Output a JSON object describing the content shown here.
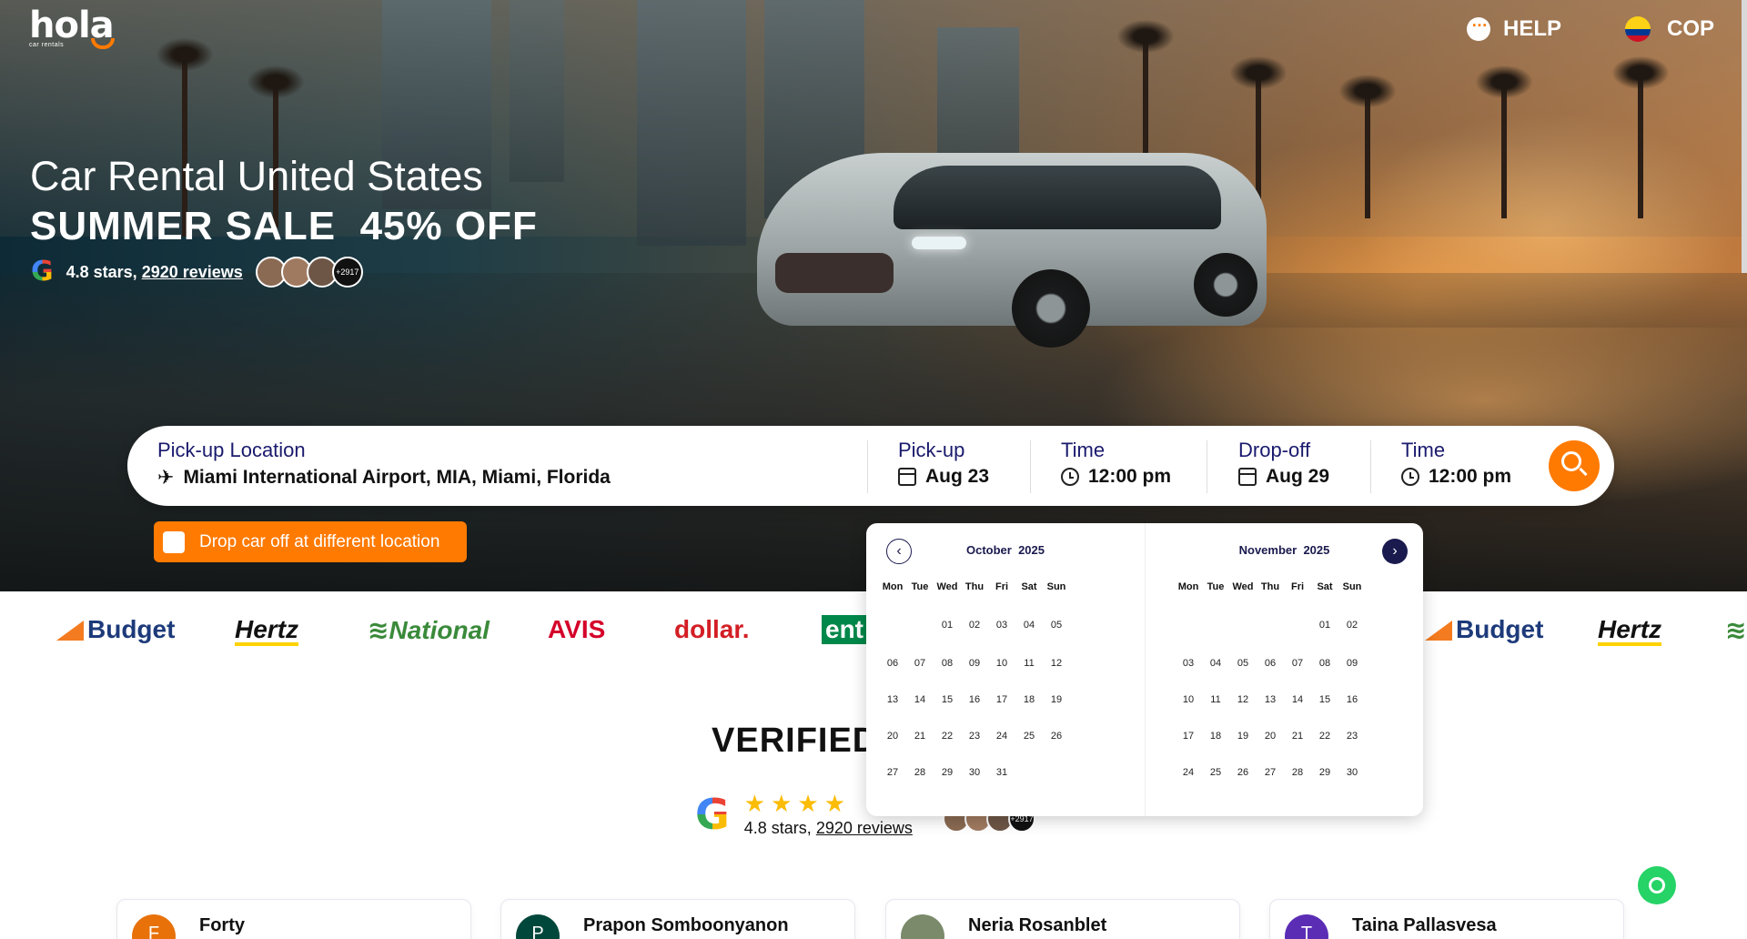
{
  "brand": {
    "name": "hola",
    "sub": "car rentals"
  },
  "topbar": {
    "help_label": "HELP",
    "currency_label": "COP"
  },
  "hero": {
    "title": "Car Rental United States",
    "sale": "SUMMER SALE  45% OFF",
    "rating_text": "4.8 stars,",
    "reviews_link": "2920 reviews",
    "avatars_more": "+2917"
  },
  "search": {
    "pickup_location_label": "Pick-up Location",
    "pickup_location_value": "Miami International Airport, MIA, Miami, Florida",
    "pickup_label": "Pick-up",
    "pickup_date": "Aug 23",
    "pickup_time_label": "Time",
    "pickup_time": "12:00 pm",
    "dropoff_label": "Drop-off",
    "dropoff_date": "Aug 29",
    "dropoff_time_label": "Time",
    "dropoff_time": "12:00 pm",
    "different_location_label": "Drop car off at different location"
  },
  "brands": [
    "Budget",
    "Hertz",
    "National",
    "AVIS",
    "dollar.",
    "ent",
    "Budget",
    "Hertz"
  ],
  "verified": {
    "heading": "VERIFIED",
    "stars": "★★★★",
    "rating_text": "4.8 stars,",
    "reviews_link": "2920 reviews",
    "avatars_more": "+2917"
  },
  "reviews": [
    {
      "initial": "F",
      "name": "Forty",
      "color": "#e8710a"
    },
    {
      "initial": "P",
      "name": "Prapon Somboonyanon",
      "color": "#00473b"
    },
    {
      "initial": "",
      "name": "Neria Rosanblet",
      "color": "#7a8a6a"
    },
    {
      "initial": "T",
      "name": "Taina Pallasvesa",
      "color": "#5b2db5"
    }
  ],
  "calendar": {
    "weekdays": [
      "Mon",
      "Tue",
      "Wed",
      "Thu",
      "Fri",
      "Sat",
      "Sun"
    ],
    "months": [
      {
        "month": "October",
        "year": "2025",
        "weeks": [
          [
            "",
            "",
            "01",
            "02",
            "03",
            "04",
            "05"
          ],
          [
            "06",
            "07",
            "08",
            "09",
            "10",
            "11",
            "12"
          ],
          [
            "13",
            "14",
            "15",
            "16",
            "17",
            "18",
            "19"
          ],
          [
            "20",
            "21",
            "22",
            "23",
            "24",
            "25",
            "26"
          ],
          [
            "27",
            "28",
            "29",
            "30",
            "31",
            "",
            ""
          ]
        ]
      },
      {
        "month": "November",
        "year": "2025",
        "weeks": [
          [
            "",
            "",
            "",
            "",
            "",
            "01",
            "02"
          ],
          [
            "03",
            "04",
            "05",
            "06",
            "07",
            "08",
            "09"
          ],
          [
            "10",
            "11",
            "12",
            "13",
            "14",
            "15",
            "16"
          ],
          [
            "17",
            "18",
            "19",
            "20",
            "21",
            "22",
            "23"
          ],
          [
            "24",
            "25",
            "26",
            "27",
            "28",
            "29",
            "30"
          ]
        ]
      }
    ]
  },
  "colors": {
    "accent": "#ff7a00",
    "navy": "#1a1a4e",
    "label": "#1a1a6e"
  },
  "icons": {
    "search": "search-icon",
    "plane": "plane-icon",
    "calendar": "calendar-icon",
    "clock": "clock-icon",
    "whatsapp": "whatsapp-icon"
  }
}
